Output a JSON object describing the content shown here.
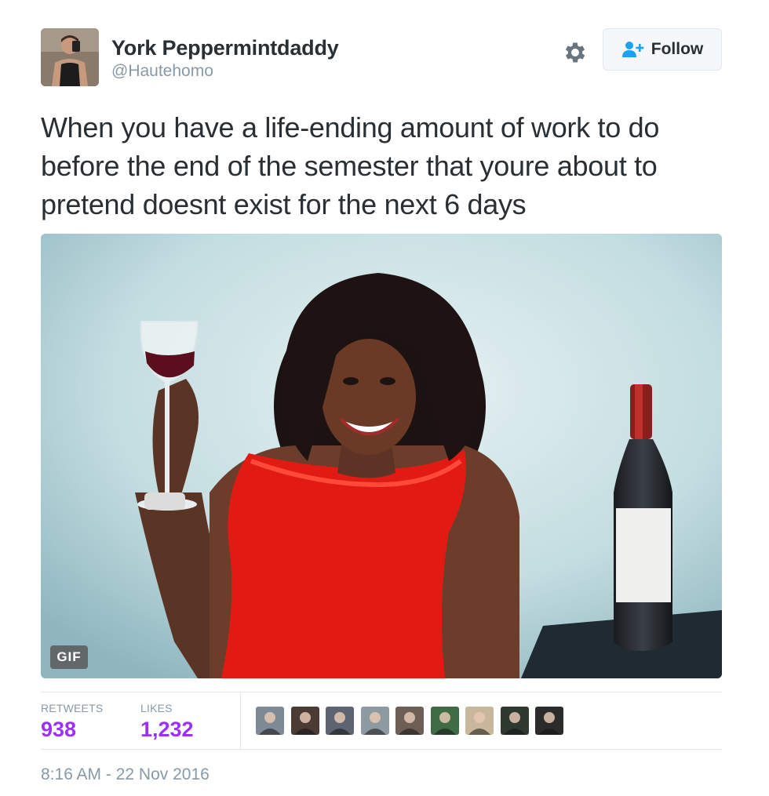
{
  "author": {
    "display_name": "York Peppermintdaddy",
    "handle": "@Hautehomo",
    "avatar_icon": "user-avatar-photo"
  },
  "actions": {
    "settings_icon": "gear-icon",
    "follow_icon": "add-user-icon",
    "follow_label": "Follow"
  },
  "tweet": {
    "text": "When you have a life-ending amount of work to do before the end of the semester that youre about to pretend doesnt exist for the next 6 days",
    "media_badge": "GIF"
  },
  "stats": {
    "retweets_label": "RETWEETS",
    "retweets_value": "938",
    "likes_label": "LIKES",
    "likes_value": "1,232"
  },
  "likers": [
    {
      "name": "liker-avatar-1",
      "color": "#7d8a96"
    },
    {
      "name": "liker-avatar-2",
      "color": "#4a3b35"
    },
    {
      "name": "liker-avatar-3",
      "color": "#5b6470"
    },
    {
      "name": "liker-avatar-4",
      "color": "#8e9aa2"
    },
    {
      "name": "liker-avatar-5",
      "color": "#6d5f56"
    },
    {
      "name": "liker-avatar-6",
      "color": "#3f6b45"
    },
    {
      "name": "liker-avatar-7",
      "color": "#c9b79c"
    },
    {
      "name": "liker-avatar-8",
      "color": "#2e3a2f"
    },
    {
      "name": "liker-avatar-9",
      "color": "#2b2b2b"
    }
  ],
  "timestamp": "8:16 AM - 22 Nov 2016",
  "colors": {
    "accent": "#9b30ff",
    "follow_icon": "#1da1f2",
    "muted": "#8899a6",
    "text": "#292f33"
  }
}
